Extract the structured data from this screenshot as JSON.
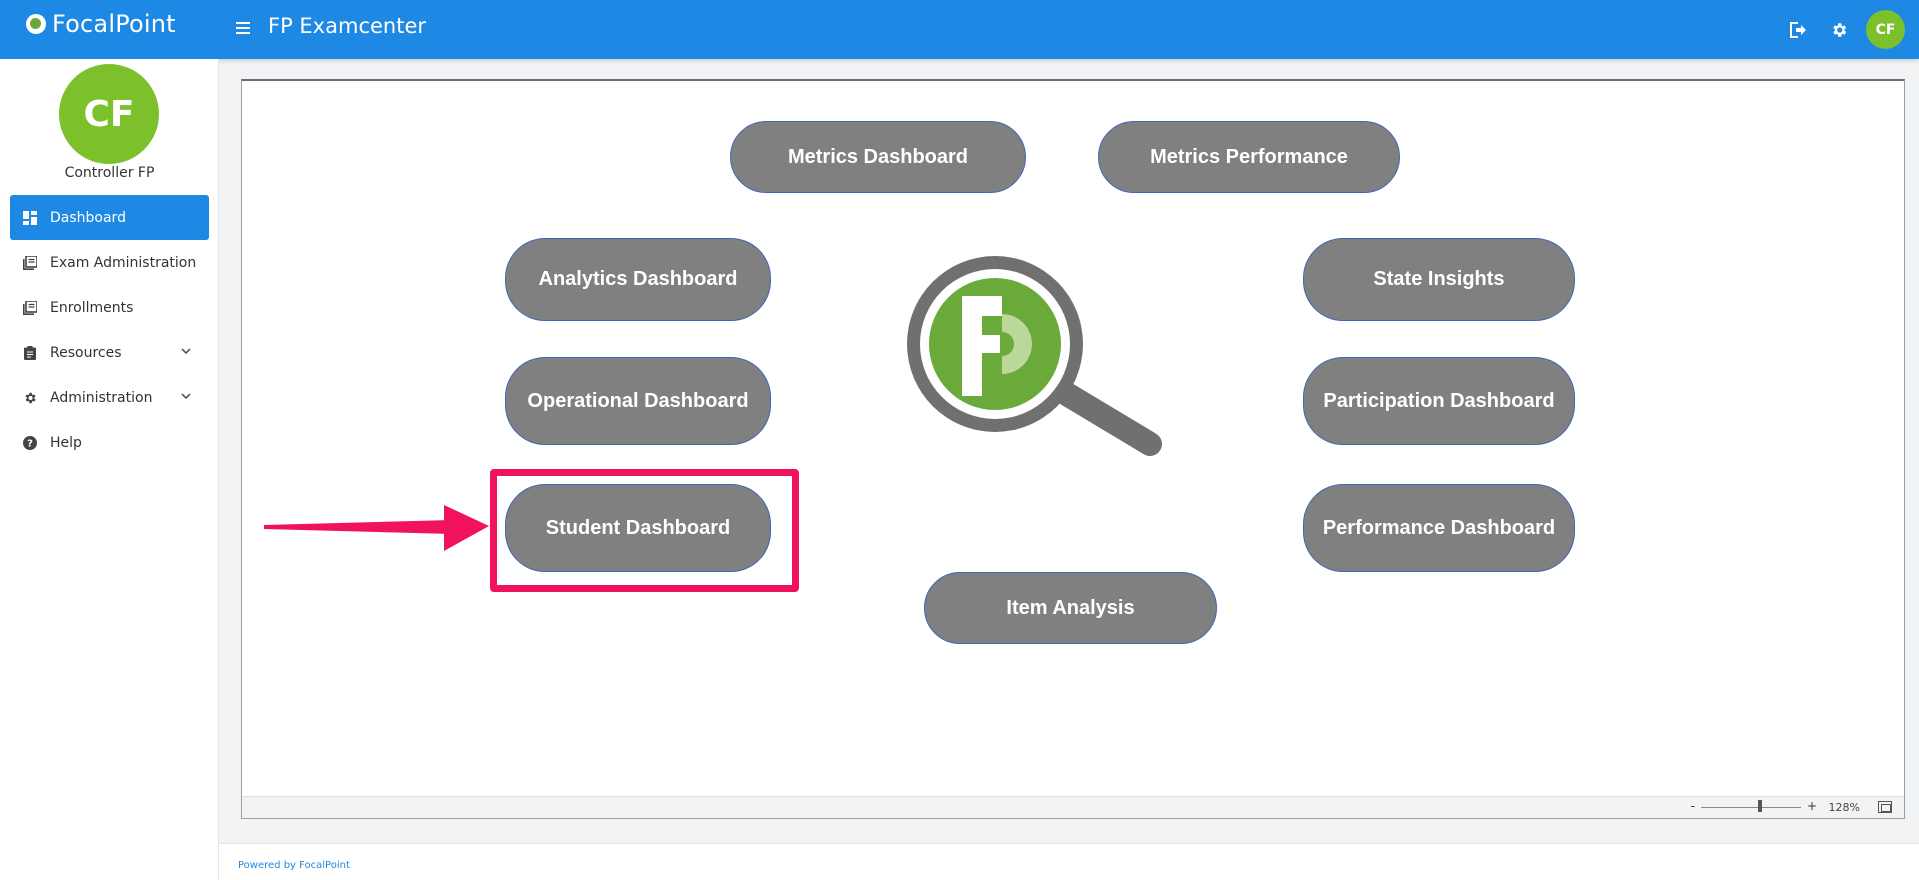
{
  "brand": {
    "name": "FocalPoint"
  },
  "header": {
    "title": "FP Examcenter",
    "avatar_initials": "CF"
  },
  "icons": {
    "menu": "hamburger-icon",
    "logout": "logout-icon",
    "settings": "gear-icon"
  },
  "sidebar": {
    "avatar_initials": "CF",
    "user_name": "Controller FP",
    "items": [
      {
        "label": "Dashboard",
        "icon": "dashboard-icon",
        "active": true
      },
      {
        "label": "Exam Administration",
        "icon": "library-icon"
      },
      {
        "label": "Enrollments",
        "icon": "library-icon"
      },
      {
        "label": "Resources",
        "icon": "clipboard-icon",
        "expandable": true
      },
      {
        "label": "Administration",
        "icon": "gear-icon",
        "expandable": true
      },
      {
        "label": "Help",
        "icon": "help-icon"
      }
    ]
  },
  "dashboard": {
    "buttons": {
      "metrics_dashboard": "Metrics Dashboard",
      "metrics_performance": "Metrics Performance",
      "analytics_dashboard": "Analytics Dashboard",
      "state_insights": "State Insights",
      "operational_dashboard": "Operational Dashboard",
      "participation_dashboard": "Participation Dashboard",
      "student_dashboard": "Student Dashboard",
      "performance_dashboard": "Performance Dashboard",
      "item_analysis": "Item Analysis"
    },
    "highlight_color": "#f0135c",
    "zoom": {
      "minus": "-",
      "plus": "+",
      "percent": "128%",
      "level": 0.6
    }
  },
  "colors": {
    "primary": "#1e88e5",
    "avatar": "#7cc02b",
    "pill": "#808080",
    "pill_border": "#3f67b6"
  },
  "footer": {
    "text": "Powered by FocalPoint"
  }
}
